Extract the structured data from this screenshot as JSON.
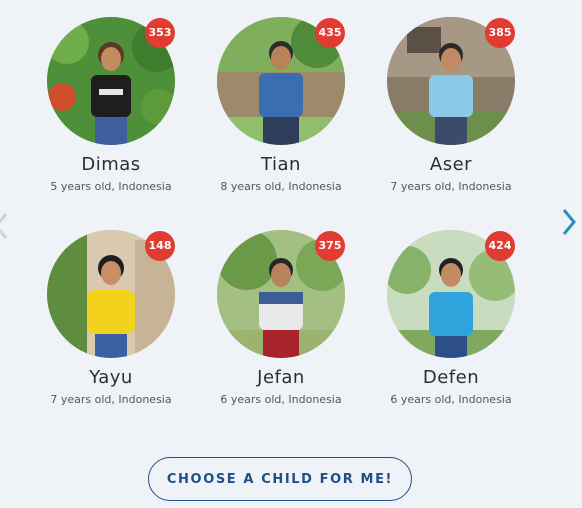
{
  "children": [
    {
      "id": "353",
      "name": "Dimas",
      "info": "5 years old, Indonesia"
    },
    {
      "id": "435",
      "name": "Tian",
      "info": "8 years old, Indonesia"
    },
    {
      "id": "385",
      "name": "Aser",
      "info": "7 years old, Indonesia"
    },
    {
      "id": "148",
      "name": "Yayu",
      "info": "7 years old, Indonesia"
    },
    {
      "id": "375",
      "name": "Jefan",
      "info": "6 years old, Indonesia"
    },
    {
      "id": "424",
      "name": "Defen",
      "info": "6 years old, Indonesia"
    }
  ],
  "nav": {
    "prev_icon": "chevron-left-icon",
    "next_icon": "chevron-right-icon"
  },
  "cta": {
    "label": "CHOOSE A CHILD FOR ME!"
  },
  "colors": {
    "badge": "#e03c31",
    "cta": "#1f4f86",
    "chevron": "#2a8fbd",
    "background": "#eff3f7"
  }
}
